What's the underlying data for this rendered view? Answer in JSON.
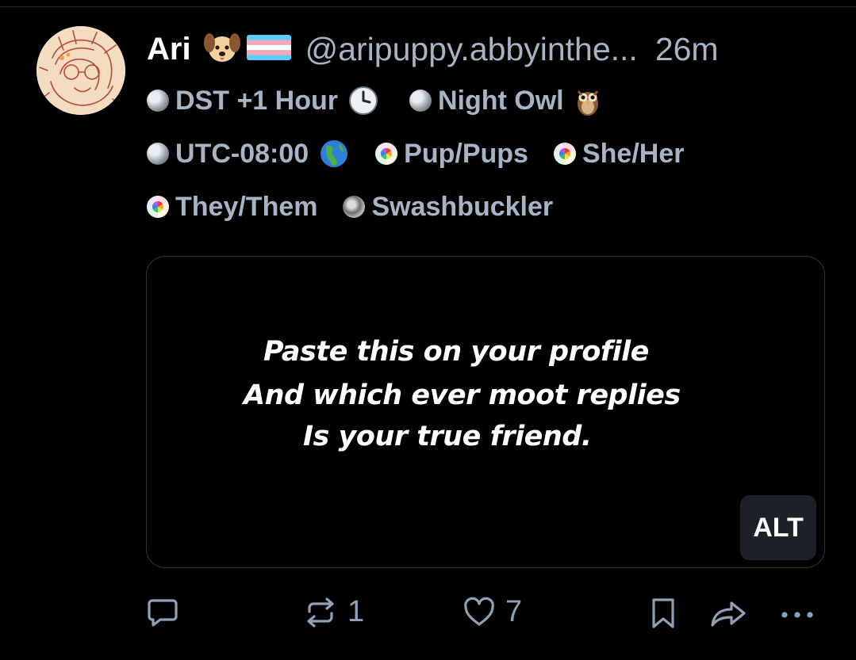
{
  "post": {
    "author_name": "Ari",
    "name_emojis": [
      "dog-face",
      "transgender-flag"
    ],
    "handle": "@aripuppy.abbyinthe...",
    "time_ago": "26m",
    "label_rows": [
      [
        {
          "text": "DST +1 Hour",
          "badge": "globe-badge",
          "trailing_emoji": "clock-icon"
        },
        {
          "text": "Night Owl",
          "badge": "globe-badge",
          "trailing_emoji": "owl-icon"
        }
      ],
      [
        {
          "text": "UTC-08:00",
          "badge": "globe-badge",
          "trailing_emoji": "earth-americas-icon"
        },
        {
          "text": "Pup/Pups",
          "badge": "pride-badge"
        },
        {
          "text": "She/Her",
          "badge": "pride-badge"
        }
      ],
      [
        {
          "text": "They/Them",
          "badge": "pride-badge"
        },
        {
          "text": "Swashbuckler",
          "badge": "swashbuckler-badge"
        }
      ]
    ],
    "image_text": [
      "Paste this on your profile",
      "And which ever moot replies",
      "Is your true friend."
    ],
    "alt_label": "ALT"
  },
  "actions": {
    "reply_count": "",
    "repost_count": "1",
    "like_count": "7"
  },
  "colors": {
    "background": "#000000",
    "muted_text": "#a7b4c6",
    "icon": "#90a0b5",
    "alt_badge_bg": "#1c2128"
  }
}
